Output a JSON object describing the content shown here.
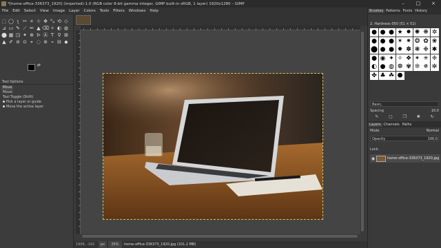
{
  "window": {
    "title": "*[home-office-336373_1920] (imported)-1.0 (RGB color 8-bit gamma integer, GIMP built-in sRGB, 1 layer) 1920x1280 – GIMP",
    "minimize": "–",
    "maximize": "□",
    "close": "×"
  },
  "menu": [
    "File",
    "Edit",
    "Select",
    "View",
    "Image",
    "Layer",
    "Colors",
    "Tools",
    "Filters",
    "Windows",
    "Help"
  ],
  "toolbox": {
    "tools": [
      "⬚",
      "◯",
      "ʅ",
      "✂",
      "⌗",
      "⊹",
      "✥",
      "⤡",
      "⟲",
      "◇",
      "⊿",
      "▭",
      "✎",
      "⟋",
      "✏",
      "▲",
      "⌫",
      "✧",
      "◐",
      "◍",
      "⬤",
      "▦",
      "◳",
      "✦",
      "⊕",
      "ᐅ",
      "Ⓐ",
      "T",
      "⚲",
      "⊞",
      "▲",
      "✐",
      "⊘",
      "⊙",
      "⌖",
      "◌",
      "⊚",
      "⌁",
      "⊟",
      "◆"
    ],
    "tool_options_title": "Tool Options",
    "tab_label": "Move",
    "options_label": "Move:",
    "tool_toggle_label": "Tool Toggle  (Shift)",
    "option_pick_layer": "Pick a layer or guide",
    "option_move_active": "Move the active layer",
    "swap_symbol": "⇄"
  },
  "status": {
    "coords": "1906, -142",
    "unit": "px",
    "zoom": "25%",
    "message": "home-office-336373_1920.jpg (101.2 MB)"
  },
  "dock": {
    "top_tabs": [
      "Brushes",
      "Patterns",
      "Fonts",
      "History"
    ],
    "brush_name": "2. Hardness 050 (51 × 51)",
    "brush_glyphs": [
      "●",
      "●",
      "●",
      "★",
      "✸",
      "✺",
      "❋",
      "✲",
      "●",
      "●",
      "●",
      "✶",
      "✷",
      "❂",
      "✿",
      "❀",
      "⬤",
      "●",
      "●",
      "✹",
      "✽",
      "❃",
      "❉",
      "✱",
      "●",
      "◉",
      "✦",
      "✧",
      "❖",
      "✴",
      "✳",
      "❈",
      "◐",
      "●",
      "◍",
      "❁",
      "✾",
      "❊",
      "✵",
      "✼",
      "✤",
      "♣",
      "☘",
      "⬣"
    ],
    "preset_label": "Basic,",
    "spacing_label": "Spacing",
    "spacing_value": "10.0",
    "layer_tabs": [
      "Layers",
      "Channels",
      "Paths"
    ],
    "mode_label": "Mode",
    "mode_value": "Normal",
    "opacity_label": "Opacity",
    "opacity_value": "100.0",
    "lock_label": "Lock:",
    "layer_name": "home-office-336373_1920.jpg",
    "eye_symbol": "◉"
  },
  "colors": {
    "selection_border": "#d8c25a",
    "foreground": "#000000",
    "background": "#ffffff"
  }
}
